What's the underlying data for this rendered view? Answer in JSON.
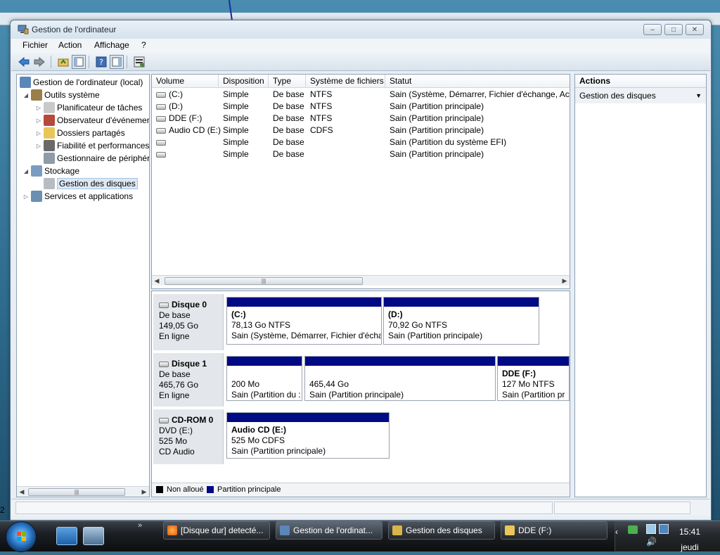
{
  "window": {
    "title": "Gestion de l'ordinateur"
  },
  "menu": [
    "Fichier",
    "Action",
    "Affichage",
    "?"
  ],
  "tree": {
    "items": [
      {
        "label": "Gestion de l'ordinateur (local)",
        "level": 0,
        "arrow": "",
        "icon": "computer-icon"
      },
      {
        "label": "Outils système",
        "level": 1,
        "arrow": "◢",
        "icon": "tools-icon"
      },
      {
        "label": "Planificateur de tâches",
        "level": 2,
        "arrow": "▷",
        "icon": "clock-icon"
      },
      {
        "label": "Observateur d'événements",
        "level": 2,
        "arrow": "▷",
        "icon": "event-viewer-icon"
      },
      {
        "label": "Dossiers partagés",
        "level": 2,
        "arrow": "▷",
        "icon": "shared-folder-icon"
      },
      {
        "label": "Fiabilité et performances",
        "level": 2,
        "arrow": "▷",
        "icon": "performance-icon"
      },
      {
        "label": "Gestionnaire de périphériques",
        "level": 2,
        "arrow": "",
        "icon": "device-manager-icon"
      },
      {
        "label": "Stockage",
        "level": 1,
        "arrow": "◢",
        "icon": "storage-icon"
      },
      {
        "label": "Gestion des disques",
        "level": 2,
        "arrow": "",
        "icon": "disk-management-icon",
        "selected": true
      },
      {
        "label": "Services et applications",
        "level": 1,
        "arrow": "▷",
        "icon": "services-icon"
      }
    ]
  },
  "volumes": {
    "columns": [
      "Volume",
      "Disposition",
      "Type",
      "Système de fichiers",
      "Statut"
    ],
    "rows": [
      [
        "(C:)",
        "Simple",
        "De base",
        "NTFS",
        "Sain (Système, Démarrer, Fichier d'échange, Actif"
      ],
      [
        "(D:)",
        "Simple",
        "De base",
        "NTFS",
        "Sain (Partition principale)"
      ],
      [
        "DDE (F:)",
        "Simple",
        "De base",
        "NTFS",
        "Sain (Partition principale)"
      ],
      [
        "Audio CD (E:)",
        "Simple",
        "De base",
        "CDFS",
        "Sain (Partition principale)"
      ],
      [
        "",
        "Simple",
        "De base",
        "",
        "Sain (Partition du système EFI)"
      ],
      [
        "",
        "Simple",
        "De base",
        "",
        "Sain (Partition principale)"
      ]
    ]
  },
  "disks": [
    {
      "name": "Disque 0",
      "line1": "De base",
      "line2": "149,05 Go",
      "line3": "En ligne",
      "partitions": [
        {
          "name": "(C:)",
          "size": "78,13 Go NTFS",
          "status": "Sain (Système, Démarrer, Fichier d'écha"
        },
        {
          "name": "(D:)",
          "size": "70,92 Go NTFS",
          "status": "Sain (Partition principale)"
        }
      ]
    },
    {
      "name": "Disque 1",
      "line1": "De base",
      "line2": "465,76 Go",
      "line3": "En ligne",
      "partitions": [
        {
          "name": "",
          "size": "200 Mo",
          "status": "Sain (Partition du :"
        },
        {
          "name": "",
          "size": "465,44 Go",
          "status": "Sain (Partition principale)"
        },
        {
          "name": "DDE  (F:)",
          "size": "127 Mo NTFS",
          "status": "Sain (Partition pr"
        }
      ]
    },
    {
      "name": "CD-ROM 0",
      "line1": "DVD (E:)",
      "line2": "525 Mo",
      "line3": "CD Audio",
      "partitions": [
        {
          "name": "Audio CD  (E:)",
          "size": "525 Mo CDFS",
          "status": "Sain (Partition principale)"
        }
      ]
    }
  ],
  "legend": {
    "unallocated": "Non alloué",
    "primary": "Partition principale"
  },
  "actions": {
    "title": "Actions",
    "subtitle": "Gestion des disques"
  },
  "taskbar": {
    "buttons": [
      "[Disque dur] detecté...",
      "Gestion de l'ordinat...",
      "Gestion des disques",
      "DDE (F:)"
    ],
    "time": "15:41",
    "day": "jeudi"
  },
  "desktop_edge_text": "2",
  "colors": {
    "partition_bar": "#000a84",
    "unallocated": "#000000"
  }
}
